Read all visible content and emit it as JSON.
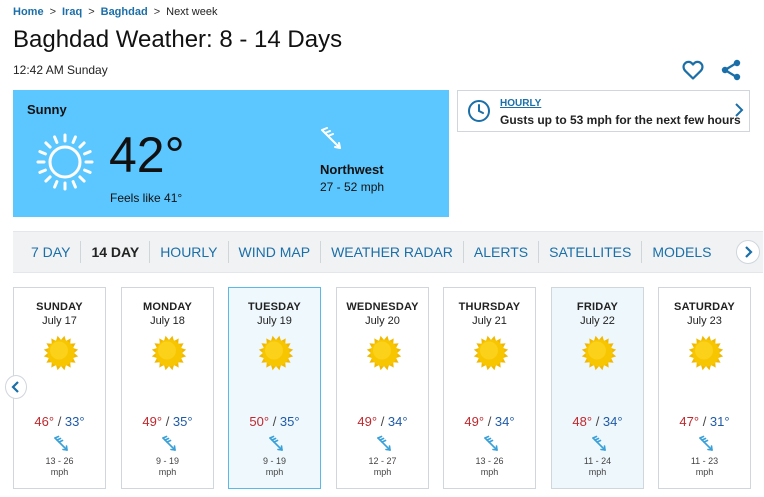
{
  "breadcrumb": {
    "items": [
      "Home",
      "Iraq",
      "Baghdad",
      "Next week"
    ],
    "sep": ">"
  },
  "page": {
    "title": "Baghdad Weather: 8 - 14 Days",
    "timestamp": "12:42 AM Sunday"
  },
  "current": {
    "condition": "Sunny",
    "temp": "42°",
    "feels_like": "Feels like 41°",
    "wind_dir": "Northwest",
    "wind_speed": "27 - 52 mph",
    "icon": "sun-outline-icon"
  },
  "hourly_alert": {
    "link": "HOURLY",
    "message": "Gusts up to 53 mph for the next few hours"
  },
  "tabs": [
    {
      "label": "7 DAY",
      "active": false
    },
    {
      "label": "14 DAY",
      "active": true
    },
    {
      "label": "HOURLY",
      "active": false
    },
    {
      "label": "WIND MAP",
      "active": false
    },
    {
      "label": "WEATHER RADAR",
      "active": false
    },
    {
      "label": "ALERTS",
      "active": false
    },
    {
      "label": "SATELLITES",
      "active": false
    },
    {
      "label": "MODELS",
      "active": false
    }
  ],
  "days": [
    {
      "name": "SUNDAY",
      "date": "July 17",
      "hi": "46°",
      "lo": "33°",
      "wind": "13 - 26",
      "unit": "mph"
    },
    {
      "name": "MONDAY",
      "date": "July 18",
      "hi": "49°",
      "lo": "35°",
      "wind": "9 - 19",
      "unit": "mph"
    },
    {
      "name": "TUESDAY",
      "date": "July 19",
      "hi": "50°",
      "lo": "35°",
      "wind": "9 - 19",
      "unit": "mph"
    },
    {
      "name": "WEDNESDAY",
      "date": "July 20",
      "hi": "49°",
      "lo": "34°",
      "wind": "12 - 27",
      "unit": "mph"
    },
    {
      "name": "THURSDAY",
      "date": "July 21",
      "hi": "49°",
      "lo": "34°",
      "wind": "13 - 26",
      "unit": "mph"
    },
    {
      "name": "FRIDAY",
      "date": "July 22",
      "hi": "48°",
      "lo": "34°",
      "wind": "11 - 24",
      "unit": "mph"
    },
    {
      "name": "SATURDAY",
      "date": "July 23",
      "hi": "47°",
      "lo": "31°",
      "wind": "11 - 23",
      "unit": "mph"
    }
  ],
  "colors": {
    "accent": "#1b6fa8",
    "current_bg": "#5cc7ff",
    "hi_temp": "#c0282d",
    "lo_temp": "#1f5aa6",
    "sun": "#f7c600"
  }
}
